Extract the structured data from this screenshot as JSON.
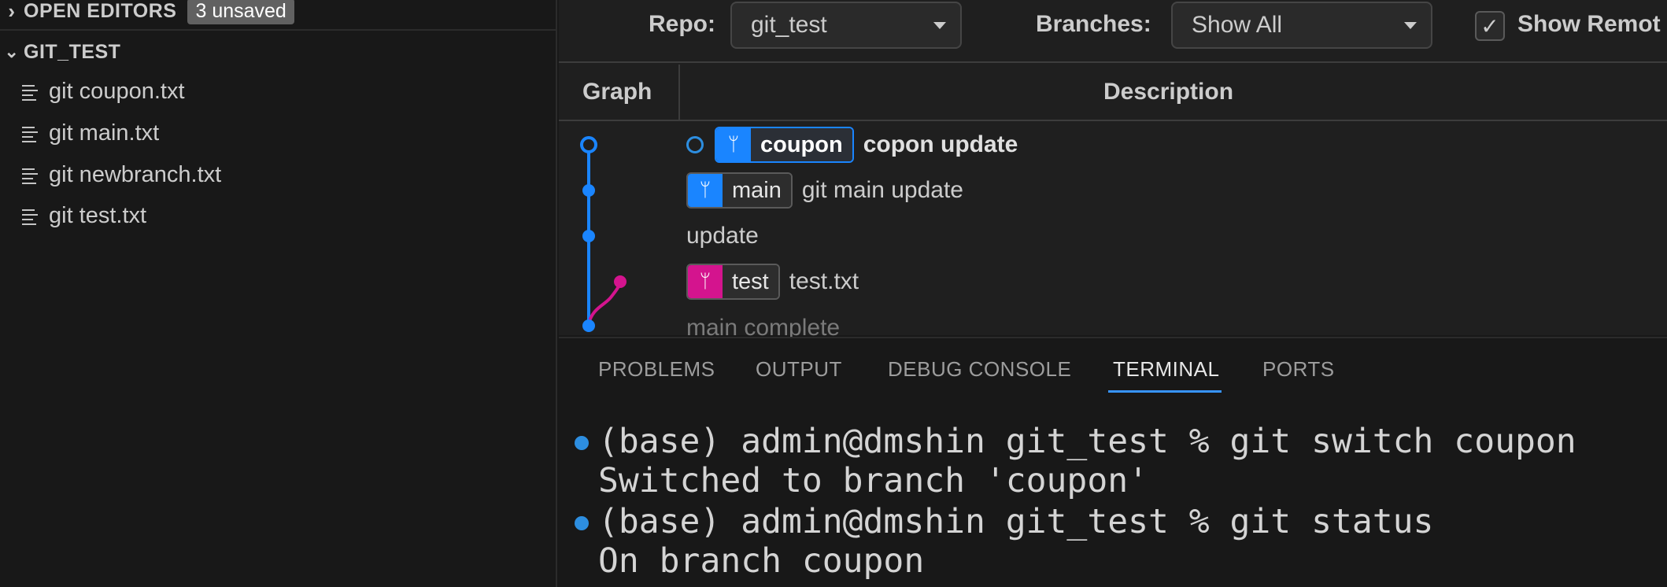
{
  "sidebar": {
    "open_editors": {
      "title": "OPEN EDITORS",
      "badge": "3 unsaved"
    },
    "folder": {
      "title": "GIT_TEST"
    },
    "files": [
      {
        "name": "git coupon.txt"
      },
      {
        "name": "git main.txt"
      },
      {
        "name": "git newbranch.txt"
      },
      {
        "name": "git test.txt"
      }
    ]
  },
  "toolbar": {
    "repo_label": "Repo:",
    "repo_value": "git_test",
    "branches_label": "Branches:",
    "branches_value": "Show All",
    "show_remote_label": "Show Remot",
    "show_remote_checked": true
  },
  "table": {
    "col_graph": "Graph",
    "col_description": "Description"
  },
  "commits": [
    {
      "branch": "coupon",
      "branch_color": "#1a85ff",
      "head": true,
      "message": "copon update"
    },
    {
      "branch": "main",
      "branch_color": "#1a85ff",
      "head": false,
      "message": "git main update"
    },
    {
      "branch": "",
      "message": "update"
    },
    {
      "branch": "test",
      "branch_color": "#d4148e",
      "head": false,
      "message": "test.txt"
    },
    {
      "branch": "",
      "message": "main complete"
    }
  ],
  "panel": {
    "tabs": [
      "PROBLEMS",
      "OUTPUT",
      "DEBUG CONSOLE",
      "TERMINAL",
      "PORTS"
    ],
    "active_tab": "TERMINAL"
  },
  "terminal": {
    "lines": [
      "(base) admin@dmshin git_test % git switch coupon",
      "Switched to branch 'coupon'",
      "(base) admin@dmshin git_test % git status",
      "On branch coupon"
    ]
  },
  "colors": {
    "accent": "#1a85ff",
    "test_branch": "#d4148e"
  }
}
